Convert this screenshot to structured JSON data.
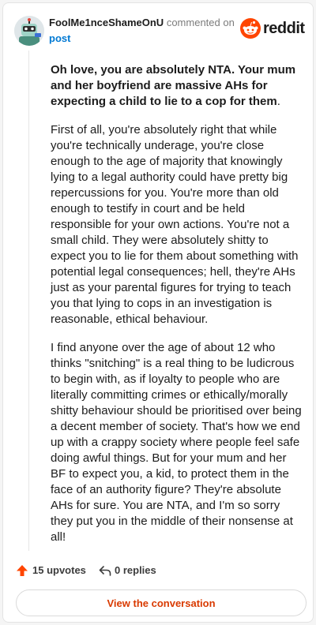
{
  "header": {
    "username": "FoolMe1nceShameOnU",
    "action": "commented on",
    "target": "post",
    "brand": "reddit"
  },
  "comment": {
    "lead_bold": "Oh love, you are absolutely NTA. Your mum and her boyfriend are massive AHs for expecting a child to lie to a cop for them",
    "lead_end": ".",
    "paragraphs": [
      "First of all, you're absolutely right that while you're technically underage, you're close enough to the age of majority that knowingly lying to a legal authority could have pretty big repercussions for you. You're more than old enough to testify in court and be held responsible for your own actions. You're not a small child. They were absolutely shitty to expect you to lie for them about something with potential legal consequences; hell, they're AHs just as your parental figures for trying to teach you that lying to cops in an investigation is reasonable, ethical behaviour.",
      "I find anyone over the age of about 12 who thinks \"snitching\" is a real thing to be ludicrous to begin with, as if loyalty to people who are literally committing crimes or ethically/morally shitty behaviour should be prioritised over being a decent member of society. That's how we end up with a crappy society where people feel safe doing awful things. But for your mum and her BF to expect you, a kid, to protect them in the face of an authority figure? They're absolute AHs for sure. You are NTA, and I'm so sorry they put you in the middle of their nonsense at all!"
    ]
  },
  "footer": {
    "upvotes": "15 upvotes",
    "replies": "0 replies",
    "view_button": "View the conversation"
  },
  "colors": {
    "brand_orange": "#ff4500",
    "link_blue": "#0079d3",
    "button_text": "#d93a00"
  },
  "icons": {
    "avatar": "snoo-avatar-icon",
    "brand": "reddit-logo-icon",
    "upvote": "upvote-arrow-icon",
    "reply": "reply-arrow-icon"
  }
}
